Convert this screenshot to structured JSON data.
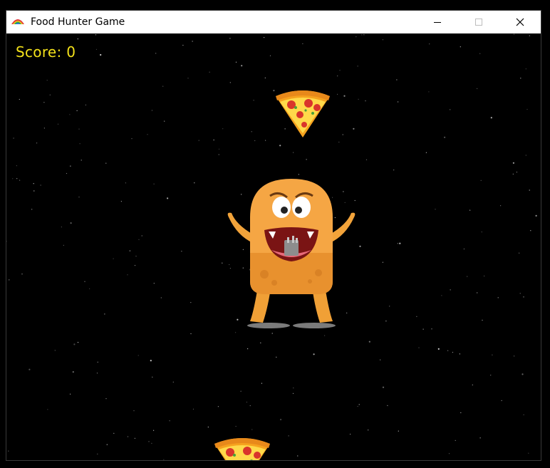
{
  "window": {
    "title": "Food Hunter Game",
    "icon": "app-color-icon",
    "controls": [
      "minimize-icon",
      "maximize-icon",
      "close-icon"
    ]
  },
  "hud": {
    "score_text": "Score: 0",
    "score_color": "#f3e11a"
  },
  "scene": {
    "background": "#000000",
    "background_style": "starfield",
    "sprites": [
      "pizza-slice",
      "orange-monster",
      "pizza-slice"
    ]
  }
}
